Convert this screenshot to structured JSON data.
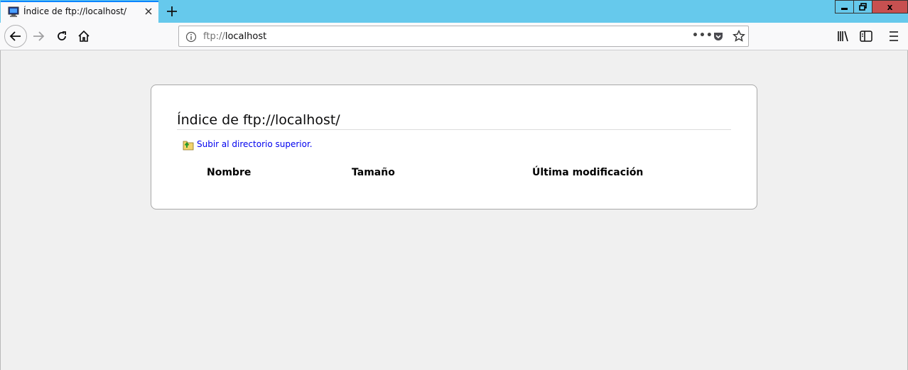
{
  "browser": {
    "tab": {
      "title": "Índice de ftp://localhost/"
    },
    "urlbar": {
      "scheme": "ftp://",
      "host": "localhost",
      "more_glyph": "•••"
    },
    "window_controls": {
      "close_glyph": "x"
    },
    "icons": [
      "monitor-favicon-icon",
      "close-icon",
      "plus-icon",
      "back-arrow-icon",
      "forward-arrow-icon",
      "reload-icon",
      "home-icon",
      "info-icon",
      "pocket-icon",
      "star-icon",
      "library-icon",
      "sidebar-icon",
      "hamburger-menu-icon",
      "folder-up-icon"
    ],
    "colors": {
      "titlebar": "#66c9ec",
      "tab_accent": "#0a84ff",
      "close_button": "#c75050",
      "link": "#0000ee"
    }
  },
  "page": {
    "title": "Índice de ftp://localhost/",
    "parent_link": "Subir al directorio superior.",
    "columns": {
      "name": "Nombre",
      "size": "Tamaño",
      "modified": "Última modificación"
    },
    "rows": []
  }
}
